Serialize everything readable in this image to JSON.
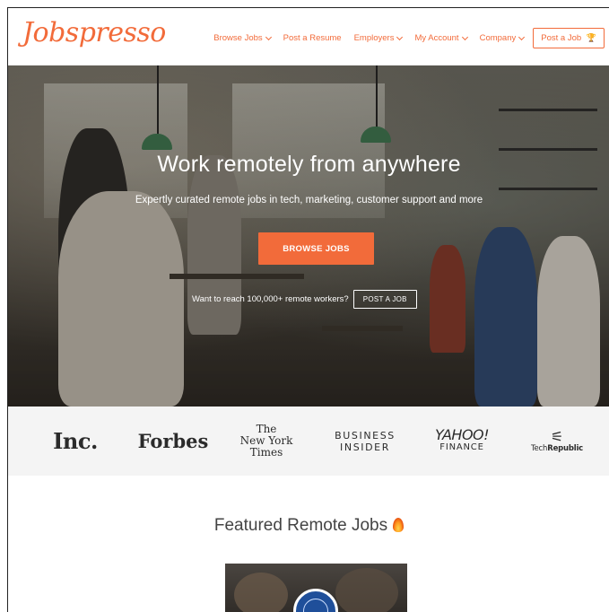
{
  "header": {
    "logo_text": "Jobspresso",
    "nav": [
      {
        "label": "Browse Jobs",
        "has_dropdown": true
      },
      {
        "label": "Post a Resume",
        "has_dropdown": false
      },
      {
        "label": "Employers",
        "has_dropdown": true
      },
      {
        "label": "My Account",
        "has_dropdown": true
      },
      {
        "label": "Company",
        "has_dropdown": true
      }
    ],
    "post_job_label": "Post a Job",
    "post_job_icon": "trophy-icon"
  },
  "hero": {
    "title": "Work remotely from anywhere",
    "subtitle": "Expertly curated remote jobs in tech, marketing, customer support and more",
    "browse_button": "BROWSE JOBS",
    "reach_text": "Want to reach 100,000+ remote workers?",
    "post_button": "POST A JOB"
  },
  "press": {
    "inc": "Inc.",
    "forbes": "Forbes",
    "nyt": [
      "The",
      "New York",
      "Times"
    ],
    "business_insider": [
      "BUSINESS",
      "INSIDER"
    ],
    "yahoo_finance": [
      "YAHOO!",
      "FINANCE"
    ],
    "techrepublic": {
      "prefix": "Tech",
      "bold": "Republic"
    }
  },
  "featured": {
    "title": "Featured Remote Jobs",
    "title_icon": "fire-icon"
  },
  "colors": {
    "brand": "#f26b3a",
    "press_bg": "#f4f4f4"
  }
}
